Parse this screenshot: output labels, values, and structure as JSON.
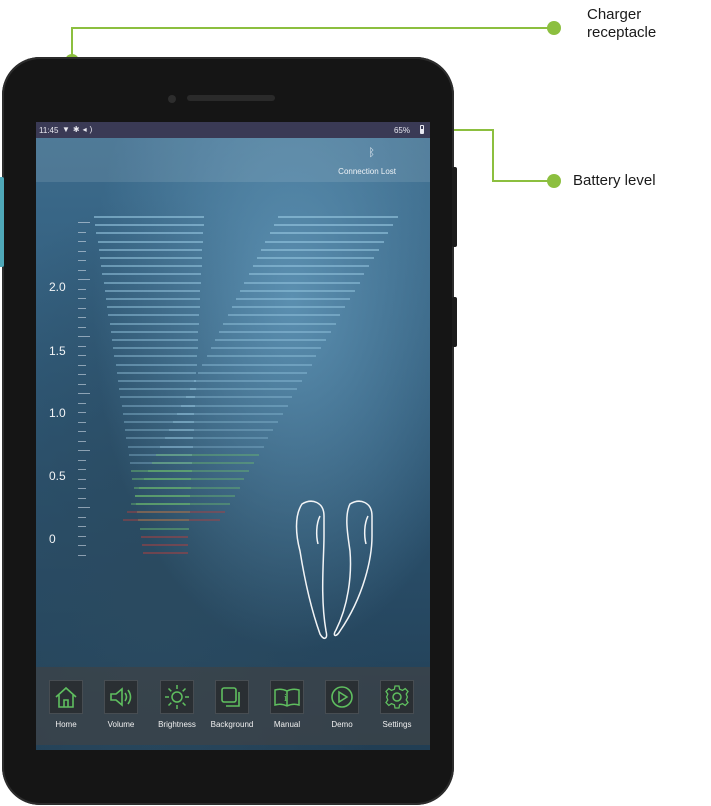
{
  "callouts": {
    "charger": "Charger receptacle",
    "battery": "Battery level"
  },
  "status_bar": {
    "time": "11:45",
    "icons": [
      "wifi-icon",
      "bluetooth-icon",
      "sound-icon"
    ],
    "battery_percent": "65%"
  },
  "header": {
    "bluetooth_status": "Connection Lost"
  },
  "scale": {
    "labels": [
      "2.0",
      "1.5",
      "1.0",
      "0.5",
      "0"
    ]
  },
  "toolbar": {
    "items": [
      {
        "label": "Home",
        "icon": "home-icon"
      },
      {
        "label": "Volume",
        "icon": "volume-icon"
      },
      {
        "label": "Brightness",
        "icon": "brightness-icon"
      },
      {
        "label": "Background",
        "icon": "background-icon"
      },
      {
        "label": "Manual",
        "icon": "manual-icon"
      },
      {
        "label": "Demo",
        "icon": "demo-play-icon"
      },
      {
        "label": "Settings",
        "icon": "settings-gear-icon"
      }
    ]
  },
  "colors": {
    "callout_line": "#8cbf3f",
    "icon_green": "#5fbf5f",
    "bar_blue": "#9ecfe8",
    "bar_green": "#6fbf6f",
    "bar_red": "#b04040"
  }
}
